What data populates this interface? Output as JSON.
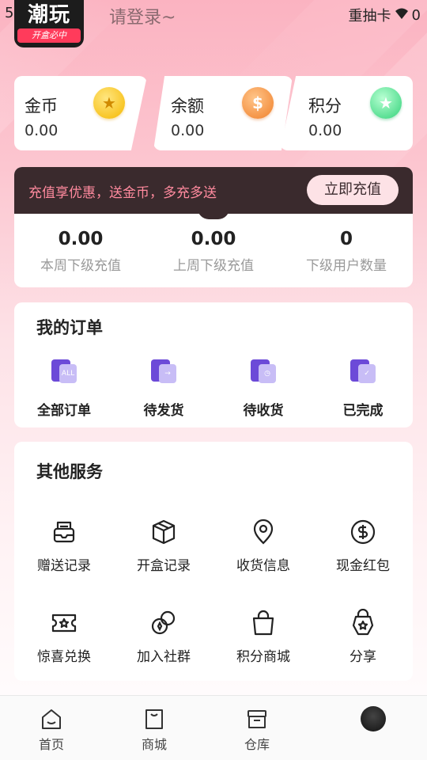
{
  "status_bar": {
    "time": "5",
    "carrier": "重抽卡",
    "signal_text": "0"
  },
  "header": {
    "logo_big": "潮玩",
    "logo_small": "开盒必中",
    "login_prompt": "请登录~"
  },
  "balances": [
    {
      "label": "金币",
      "value": "0.00",
      "icon": "star-coin-icon",
      "color": "#f5b800"
    },
    {
      "label": "余额",
      "value": "0.00",
      "icon": "dollar-coin-icon",
      "color": "#f0802a"
    },
    {
      "label": "积分",
      "value": "0.00",
      "icon": "green-star-coin-icon",
      "color": "#33d27a"
    }
  ],
  "recharge": {
    "promo_text": "充值享优惠，送金币，多充多送",
    "button_label": "立即充值",
    "stats": [
      {
        "value": "0.00",
        "label": "本周下级充值"
      },
      {
        "value": "0.00",
        "label": "上周下级充值"
      },
      {
        "value": "0",
        "label": "下级用户数量"
      }
    ]
  },
  "orders": {
    "title": "我的订单",
    "items": [
      {
        "label": "全部订单",
        "icon": "all-orders-icon",
        "badge": "ALL"
      },
      {
        "label": "待发货",
        "icon": "to-ship-icon",
        "badge": "→"
      },
      {
        "label": "待收货",
        "icon": "to-receive-icon",
        "badge": "◷"
      },
      {
        "label": "已完成",
        "icon": "completed-icon",
        "badge": "✓"
      }
    ]
  },
  "services": {
    "title": "其他服务",
    "items": [
      {
        "label": "赠送记录",
        "icon": "gift-record-icon"
      },
      {
        "label": "开盒记录",
        "icon": "box-record-icon"
      },
      {
        "label": "收货信息",
        "icon": "location-icon"
      },
      {
        "label": "现金红包",
        "icon": "cash-envelope-icon"
      },
      {
        "label": "惊喜兑换",
        "icon": "ticket-icon"
      },
      {
        "label": "加入社群",
        "icon": "community-icon"
      },
      {
        "label": "积分商城",
        "icon": "shopping-bag-icon"
      },
      {
        "label": "分享",
        "icon": "share-icon"
      }
    ]
  },
  "bottom_nav": [
    {
      "label": "首页",
      "icon": "home-icon"
    },
    {
      "label": "商城",
      "icon": "mall-icon"
    },
    {
      "label": "仓库",
      "icon": "warehouse-icon"
    },
    {
      "label": "",
      "icon": "avatar-icon"
    }
  ],
  "colors": {
    "accent": "#6c4ad8",
    "dark_band": "#3a2a2d",
    "promo_text": "#ff8a9e"
  }
}
